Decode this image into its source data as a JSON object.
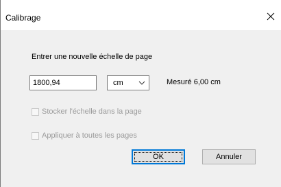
{
  "window": {
    "title": "Calibrage",
    "close_icon": "close-icon"
  },
  "form": {
    "instruction": "Entrer une nouvelle échelle de page",
    "scale_value": "1800,94",
    "unit_selected": "cm",
    "measured_text": "Mesuré 6,00 cm"
  },
  "options": {
    "store_scale_label": "Stocker l'échelle dans la page",
    "store_scale_checked": false,
    "store_scale_enabled": false,
    "apply_all_label": "Appliquer à toutes les pages",
    "apply_all_checked": false,
    "apply_all_enabled": false
  },
  "buttons": {
    "ok_label": "OK",
    "cancel_label": "Annuler"
  },
  "colors": {
    "client_background": "#f0f0f0",
    "focus_accent": "#0078d7",
    "disabled_text": "#9a9a9a"
  }
}
